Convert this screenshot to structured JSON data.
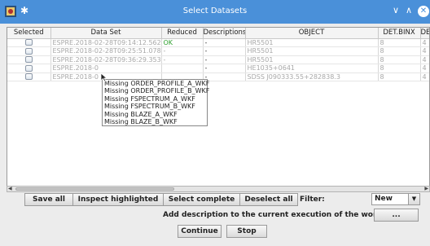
{
  "window": {
    "title": "Select Datasets",
    "minimize_glyph": "∨",
    "maximize_glyph": "∧",
    "close_glyph": "✕",
    "app_icon": "app-icon",
    "pin_glyph": "✱"
  },
  "table": {
    "columns": [
      "Selected",
      "Data Set",
      "Reduced",
      "Descriptions",
      "OBJECT",
      "DET.BINX",
      "DET.BINY"
    ],
    "rows": [
      {
        "dataset": "ESPRE.2018-02-28T09:14:12.562",
        "reduced": "OK",
        "description": "-",
        "object": "HR5501",
        "binx": "8",
        "biny": "4"
      },
      {
        "dataset": "ESPRE.2018-02-28T09:25:51.078",
        "reduced": "-",
        "description": "-",
        "object": "HR5501",
        "binx": "8",
        "biny": "4"
      },
      {
        "dataset": "ESPRE.2018-02-28T09:36:29.353",
        "reduced": "-",
        "description": "-",
        "object": "HR5501",
        "binx": "8",
        "biny": "4"
      },
      {
        "dataset": "ESPRE.2018-0",
        "reduced": "",
        "description": "-",
        "object": "HE1035+0641",
        "binx": "8",
        "biny": "4"
      },
      {
        "dataset": "ESPRE.2018-0",
        "reduced": "",
        "description": "-",
        "object": "SDSS J090333.55+282838.3",
        "binx": "8",
        "biny": "4"
      }
    ]
  },
  "tooltip": {
    "lines": [
      "Missing ORDER_PROFILE_A_WKF",
      "Missing ORDER_PROFILE_B_WKF",
      "Missing FSPECTRUM_A_WKF",
      "Missing FSPECTRUM_B_WKF",
      "Missing BLAZE_A_WKF",
      "Missing BLAZE_B_WKF"
    ]
  },
  "scrollbar": {
    "left_arrow": "◀",
    "right_arrow": "▶"
  },
  "actions": {
    "save_all": "Save all",
    "inspect_highlighted": "Inspect highlighted",
    "select_complete": "Select complete",
    "deselect_all": "Deselect all",
    "filter_label": "Filter:",
    "filter_value": "New",
    "filter_caret": "▼",
    "description_label": "Add description to the current execution of the workflow:",
    "description_button": "...",
    "continue": "Continue",
    "stop": "Stop"
  }
}
